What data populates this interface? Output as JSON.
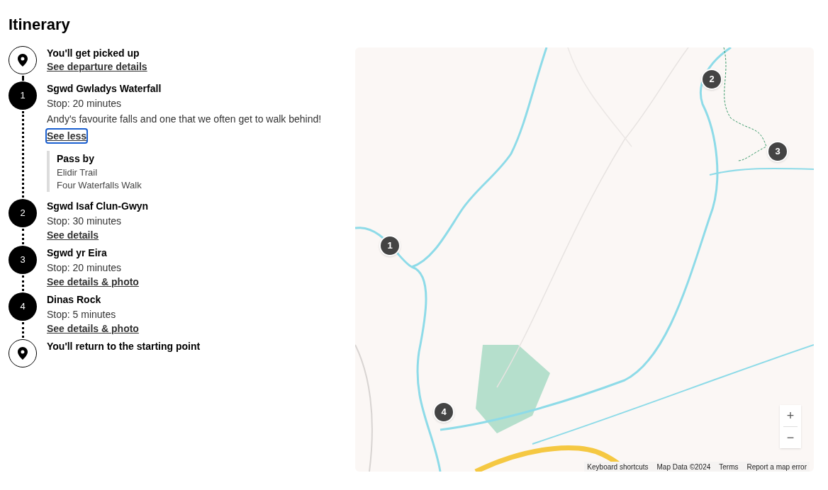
{
  "title": "Itinerary",
  "steps": [
    {
      "kind": "start",
      "title": "You'll get picked up",
      "link": {
        "label": "See departure details",
        "focused": false
      }
    },
    {
      "kind": "stop",
      "number": "1",
      "title": "Sgwd Gwladys Waterfall",
      "stop": "Stop: 20 minutes",
      "description": "Andy's favourite falls and one that we often get to walk behind!",
      "link": {
        "label": "See less",
        "focused": true
      },
      "pass_by": {
        "title": "Pass by",
        "items": [
          "Elidir Trail",
          "Four Waterfalls Walk"
        ]
      }
    },
    {
      "kind": "stop",
      "number": "2",
      "title": "Sgwd Isaf Clun-Gwyn",
      "stop": "Stop: 30 minutes",
      "link": {
        "label": "See details",
        "focused": false
      }
    },
    {
      "kind": "stop",
      "number": "3",
      "title": "Sgwd yr Eira",
      "stop": "Stop: 20 minutes",
      "link": {
        "label": "See details & photo",
        "focused": false
      }
    },
    {
      "kind": "stop",
      "number": "4",
      "title": "Dinas Rock",
      "stop": "Stop: 5 minutes",
      "link": {
        "label": "See details & photo",
        "focused": false
      }
    },
    {
      "kind": "end",
      "title": "You'll return to the starting point"
    }
  ],
  "map": {
    "markers": [
      "1",
      "2",
      "3",
      "4"
    ],
    "zoom_in": "+",
    "zoom_out": "−",
    "footer": [
      "Keyboard shortcuts",
      "Map Data ©2024",
      "Terms",
      "Report a map error"
    ]
  }
}
